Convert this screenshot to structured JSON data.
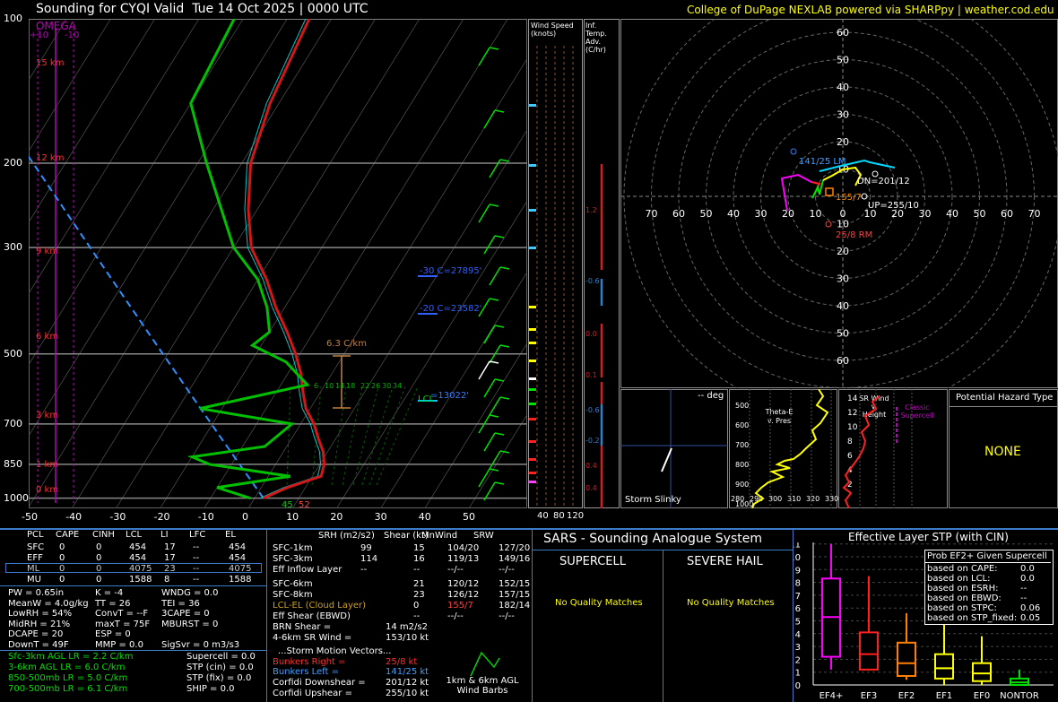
{
  "header": {
    "title": "Sounding for CYQI Valid  Tue 14 Oct 2025 | 0000 UTC",
    "credit": "College of DuPage NEXLAB powered via SHARPpy | weather.cod.edu"
  },
  "skewt": {
    "omega_label": "OMEGA",
    "omega_ticks": [
      "+10",
      "-10"
    ],
    "pressure_ticks": [
      "100",
      "200",
      "300",
      "500",
      "700",
      "850",
      "1000"
    ],
    "height_ticks": [
      "15 km",
      "12 km",
      "9 km",
      "6 km",
      "3 km",
      "1 km",
      "0 km"
    ],
    "temp_ticks": [
      "-50",
      "-40",
      "-30",
      "-20",
      "-10",
      "0",
      "10",
      "20",
      "30",
      "40",
      "50"
    ],
    "annotations": {
      "lapse_rate": "6.3 C/km",
      "iso_m30": "-30 C=27895'",
      "iso_m20": "-20 C=23582'",
      "wbz": "=13022'",
      "lcl": "LCL",
      "sfc_readout": "45",
      "sfc_readout2": "52",
      "mixing_ratios": [
        "6",
        "10",
        "14",
        "18",
        "22",
        "26",
        "30",
        "34"
      ]
    },
    "colors": {
      "temperature": "#ff2020",
      "dewpoint": "#00d000",
      "virtual": "#00c8c8",
      "parcel": "#3090ff",
      "omega": "#c000c0"
    },
    "wind_speed_title": "Wind Speed (knots)",
    "wind_speed_ticks": [
      "40",
      "80",
      "120"
    ],
    "inf_temp_title": "Inf. Temp. Adv. (C/hr)",
    "inf_temp_values": [
      "1.2",
      "-0.6",
      "0.0",
      "0.1",
      "-0.6",
      "-0.2",
      "0.4",
      "0.4"
    ]
  },
  "chart_data": [
    {
      "type": "line",
      "title": "Sounding for CYQI Valid  Tue 14 Oct 2025 | 0000 UTC",
      "xlabel": "Temperature (C)",
      "ylabel": "Pressure (mb)",
      "x_ticks": [
        -50,
        -40,
        -30,
        -20,
        -10,
        0,
        10,
        20,
        30,
        40,
        50
      ],
      "y_ticks": [
        100,
        200,
        300,
        500,
        700,
        850,
        1000
      ],
      "y_scale": "log",
      "series": [
        {
          "name": "Temperature",
          "points": [
            [
              2,
              1000
            ],
            [
              6,
              950
            ],
            [
              12,
              900
            ],
            [
              11,
              850
            ],
            [
              9,
              800
            ],
            [
              6,
              750
            ],
            [
              3,
              700
            ],
            [
              -1,
              650
            ],
            [
              -4,
              600
            ],
            [
              -7,
              550
            ],
            [
              -11,
              500
            ],
            [
              -16,
              450
            ],
            [
              -22,
              400
            ],
            [
              -28,
              350
            ],
            [
              -36,
              300
            ],
            [
              -42,
              250
            ],
            [
              -48,
              200
            ],
            [
              -52,
              150
            ],
            [
              -55,
              100
            ]
          ]
        },
        {
          "name": "Dewpoint",
          "points": [
            [
              -1,
              1000
            ],
            [
              -10,
              950
            ],
            [
              5,
              900
            ],
            [
              -15,
              850
            ],
            [
              -20,
              820
            ],
            [
              -5,
              780
            ],
            [
              -2,
              700
            ],
            [
              -25,
              650
            ],
            [
              -4,
              580
            ],
            [
              -12,
              520
            ],
            [
              -22,
              480
            ],
            [
              -20,
              450
            ],
            [
              -24,
              400
            ],
            [
              -30,
              350
            ],
            [
              -40,
              300
            ],
            [
              -58,
              200
            ],
            [
              -70,
              150
            ],
            [
              -72,
              100
            ]
          ]
        }
      ]
    },
    {
      "type": "scatter",
      "title": "Hodograph",
      "x_ticks": [
        "70",
        "60",
        "50",
        "40",
        "30",
        "20",
        "10",
        "0",
        "10",
        "20",
        "30",
        "40",
        "50",
        "60",
        "70"
      ],
      "y_ticks": [
        "60",
        "50",
        "40",
        "30",
        "20",
        "10",
        "10",
        "20",
        "30",
        "40",
        "50",
        "60"
      ],
      "labels": [
        "141/25 LM",
        "DN=201/12",
        "155/7",
        "UP=255/10",
        "25/8 RM"
      ]
    },
    {
      "type": "bar",
      "title": "Effective Layer STP (with CIN)",
      "categories": [
        "EF4+",
        "EF3",
        "EF2",
        "EF1",
        "EF0",
        "NONTOR"
      ],
      "series": [
        {
          "name": "Median",
          "values": [
            5.3,
            2.4,
            1.7,
            1.3,
            0.9,
            0.2
          ]
        },
        {
          "name": "25th pct",
          "values": [
            2.2,
            1.2,
            0.7,
            0.5,
            0.3,
            0.0
          ]
        },
        {
          "name": "75th pct",
          "values": [
            8.3,
            4.1,
            3.3,
            2.4,
            1.7,
            0.5
          ]
        }
      ],
      "ylim": [
        0,
        11
      ],
      "y_ticks": [
        0,
        1,
        2,
        3,
        4,
        5,
        6,
        7,
        8,
        9,
        10,
        11
      ]
    }
  ],
  "hodo": {
    "labels": [
      "141/25 LM",
      "DN=201/12",
      "155/7",
      "UP=255/10",
      "25/8 RM"
    ]
  },
  "slinky": {
    "deg": "-- deg",
    "title": "Storm Slinky"
  },
  "thetae": {
    "title": "Theta-E v. Pres",
    "x": [
      "280",
      "290",
      "300",
      "310",
      "320",
      "330"
    ],
    "y": [
      "500",
      "600",
      "700",
      "800",
      "900",
      "1000"
    ]
  },
  "srwind": {
    "title": "SR Wind v. Height",
    "legend": "Classic Supercell",
    "y": [
      "14",
      "12",
      "10",
      "8",
      "6",
      "4",
      "2"
    ]
  },
  "hazard": {
    "title": "Potential Hazard Type",
    "value": "NONE"
  },
  "parcels": {
    "headers": [
      "PCL",
      "CAPE",
      "CINH",
      "LCL",
      "LI",
      "LFC",
      "EL"
    ],
    "rows": [
      [
        "SFC",
        "0",
        "0",
        "454",
        "17",
        "--",
        "454"
      ],
      [
        "EFF",
        "0",
        "0",
        "454",
        "17",
        "--",
        "454"
      ],
      [
        "ML",
        "0",
        "0",
        "4075",
        "23",
        "--",
        "4075"
      ],
      [
        "MU",
        "0",
        "0",
        "1588",
        "8",
        "--",
        "1588"
      ]
    ]
  },
  "indices": {
    "col1": [
      "PW = 0.65in",
      "MeanW = 4.0g/kg",
      "LowRH = 54%",
      "MidRH = 21%",
      "DCAPE = 20",
      "DownT = 49F"
    ],
    "col2": [
      "K = -4",
      "TT = 26",
      "ConvT = --F",
      "maxT = 75F",
      "ESP = 0",
      "MMP = 0.0"
    ],
    "col3": [
      "WNDG = 0.0",
      "TEI = 36",
      "3CAPE = 0",
      "MBURST = 0",
      "",
      "SigSvr = 0 m3/s3"
    ]
  },
  "lapse": [
    "Sfc-3km AGL LR = 2.2 C/km",
    "3-6km AGL LR = 6.0 C/km",
    "850-500mb LR = 5.0 C/km",
    "700-500mb LR = 6.1 C/km"
  ],
  "composites": [
    "Supercell = 0.0",
    "STP (cin) = 0.0",
    "STP (fix) = 0.0",
    "SHIP = 0.0"
  ],
  "kinematics": {
    "headers": [
      "SRH (m2/s2)",
      "Shear (kt)",
      "MnWind",
      "SRW"
    ],
    "rows": [
      [
        "SFC-1km",
        "99",
        "15",
        "104/20",
        "127/20"
      ],
      [
        "SFC-3km",
        "114",
        "16",
        "119/13",
        "149/16"
      ],
      [
        "Eff Inflow Layer",
        "--",
        "--",
        "--/--",
        "--/--"
      ],
      [
        "SFC-6km",
        "21",
        "120/12",
        "152/15"
      ],
      [
        "SFC-8km",
        "23",
        "126/12",
        "157/15"
      ],
      [
        "LCL-EL (Cloud Layer)",
        "0",
        "155/7",
        "182/14"
      ],
      [
        "Eff Shear (EBWD)",
        "--",
        "--/--",
        "--/--"
      ]
    ],
    "brn": "BRN Shear =",
    "brn_val": "14 m2/s2",
    "sr46": "4-6km SR Wind =",
    "sr46_val": "153/10 kt",
    "storm_vectors": "...Storm Motion Vectors...",
    "bunkers_right": "Bunkers Right =",
    "bunkers_right_val": "25/8 kt",
    "bunkers_left": "Bunkers Left =",
    "bunkers_left_val": "141/25 kt",
    "corfidi_down": "Corfidi Downshear =",
    "corfidi_down_val": "201/12 kt",
    "corfidi_up": "Corfidi Upshear =",
    "corfidi_up_val": "255/10 kt",
    "barbs_label": "1km & 6km AGL Wind Barbs"
  },
  "sars": {
    "title": "SARS - Sounding Analogue System",
    "supercell": "SUPERCELL",
    "hail": "SEVERE HAIL",
    "supercell_result": "No Quality Matches",
    "hail_result": "No Quality Matches"
  },
  "stp": {
    "title": "Effective Layer STP (with CIN)",
    "box_title": "Prob EF2+ Given Supercell",
    "box_rows": [
      [
        "based on CAPE:",
        "0.0"
      ],
      [
        "based on LCL:",
        "0.0"
      ],
      [
        "based on ESRH:",
        "--"
      ],
      [
        "based on EBWD:",
        "--"
      ],
      [
        "based on STPC:",
        "0.06"
      ],
      [
        "based on STP_fixed:",
        "0.05"
      ]
    ]
  }
}
